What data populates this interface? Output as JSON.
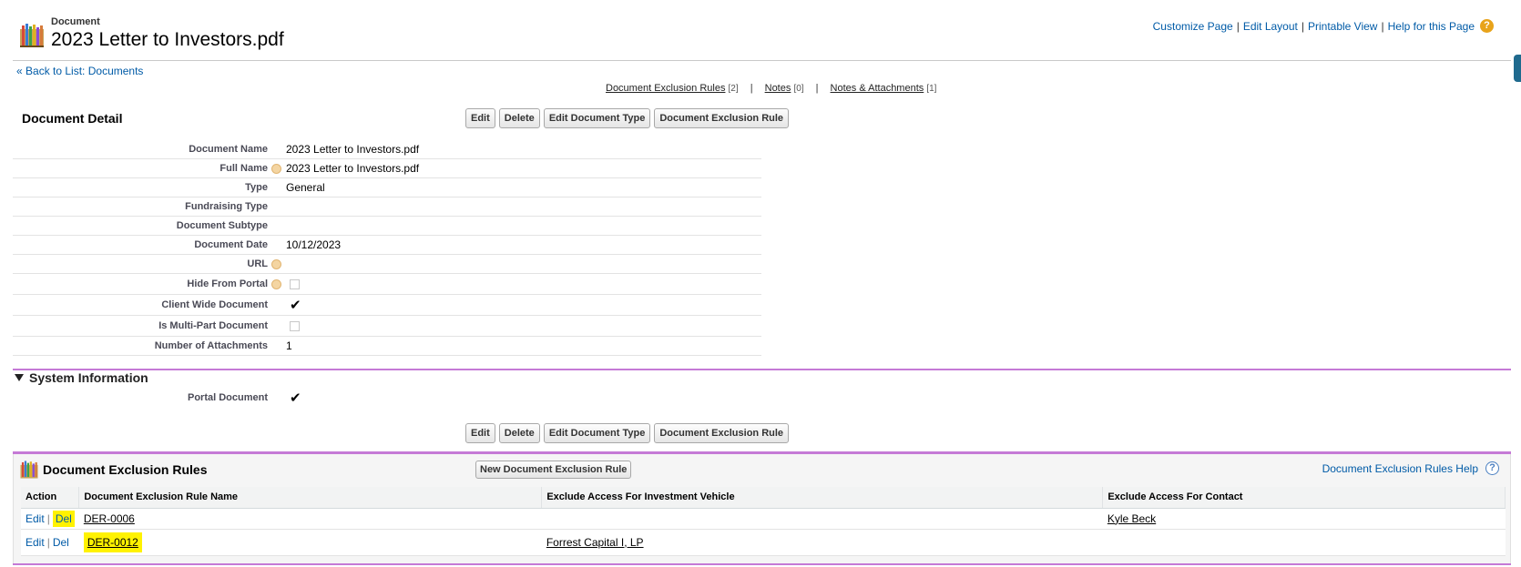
{
  "header": {
    "type_label": "Document",
    "title": "2023 Letter to Investors.pdf",
    "links": [
      "Customize Page",
      "Edit Layout",
      "Printable View",
      "Help for this Page"
    ],
    "help_icon": "?"
  },
  "back_link": {
    "prefix": "«",
    "label": "Back to List: Documents"
  },
  "related_links": [
    {
      "label": "Document Exclusion Rules",
      "count": "[2]"
    },
    {
      "label": "Notes",
      "count": "[0]"
    },
    {
      "label": "Notes & Attachments",
      "count": "[1]"
    }
  ],
  "detail": {
    "title": "Document Detail",
    "buttons": [
      "Edit",
      "Delete",
      "Edit Document Type",
      "Document Exclusion Rule"
    ],
    "fields": [
      {
        "label": "Document Name",
        "value": "2023 Letter to Investors.pdf"
      },
      {
        "label": "Full Name",
        "value": "2023 Letter to Investors.pdf"
      },
      {
        "label": "Type",
        "value": "General"
      },
      {
        "label": "Fundraising Type",
        "value": ""
      },
      {
        "label": "Document Subtype",
        "value": ""
      },
      {
        "label": "Document Date",
        "value": "10/12/2023"
      },
      {
        "label": "URL",
        "value": ""
      },
      {
        "label": "Hide From Portal",
        "checked": false
      },
      {
        "label": "Client Wide Document",
        "checked": true
      },
      {
        "label": "Is Multi-Part Document",
        "checked": false
      },
      {
        "label": "Number of Attachments",
        "value": "1"
      }
    ]
  },
  "system_info": {
    "title": "System Information",
    "fields": [
      {
        "label": "Portal Document",
        "checked": true
      }
    ],
    "buttons": [
      "Edit",
      "Delete",
      "Edit Document Type",
      "Document Exclusion Rule"
    ]
  },
  "exclusion_rules": {
    "title": "Document Exclusion Rules",
    "new_button": "New Document Exclusion Rule",
    "help_link": "Document Exclusion Rules Help",
    "help_icon": "?",
    "columns": [
      "Action",
      "Document Exclusion Rule Name",
      "Exclude Access For Investment Vehicle",
      "Exclude Access For Contact"
    ],
    "action_edit": "Edit",
    "action_sep": "|",
    "action_del": "Del",
    "rows": [
      {
        "name": "DER-0006",
        "vehicle": "",
        "contact": "Kyle Beck"
      },
      {
        "name": "DER-0012",
        "vehicle": "Forrest Capital I, LP",
        "contact": ""
      }
    ]
  },
  "colors": {
    "link": "#015ba7",
    "accent_rule": "#c57ad6",
    "highlight": "#fff200",
    "help_orange": "#e8a31a"
  }
}
